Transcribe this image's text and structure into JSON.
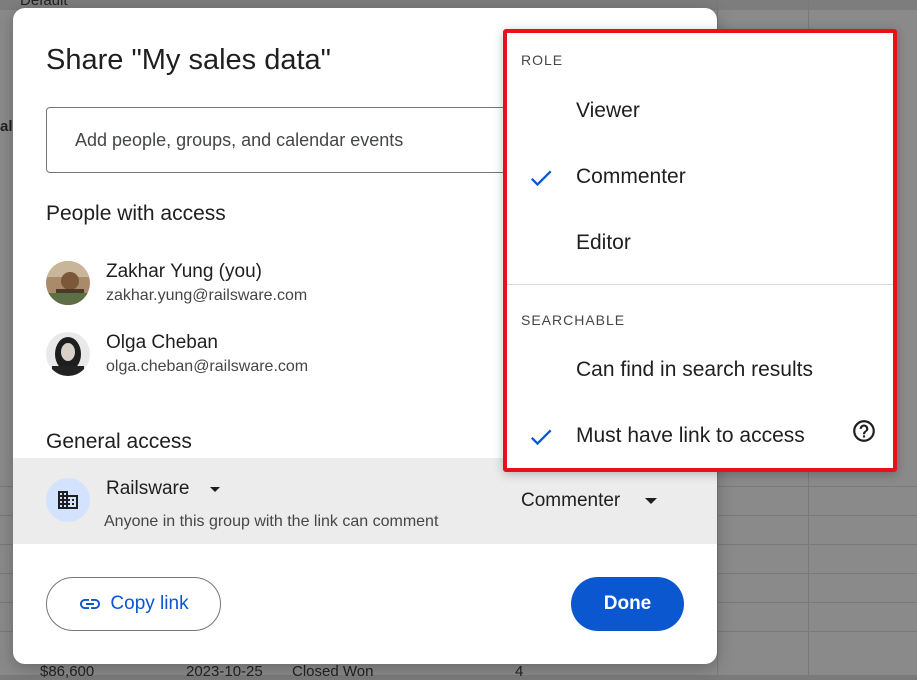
{
  "background": {
    "partial_label": "Default",
    "bottom_cells": [
      "$86,600",
      "2023-10-25",
      "Closed Won",
      "4"
    ],
    "left_header": "al"
  },
  "dialog": {
    "title": "Share \"My sales data\"",
    "add_placeholder": "Add people, groups, and calendar events",
    "people_heading": "People with access",
    "people": [
      {
        "name": "Zakhar Yung (you)",
        "email": "zakhar.yung@railsware.com"
      },
      {
        "name": "Olga Cheban",
        "email": "olga.cheban@railsware.com"
      }
    ],
    "general_heading": "General access",
    "general": {
      "org_name": "Railsware",
      "description": "Anyone in this group with the link can comment",
      "role": "Commenter"
    },
    "copy_link_label": "Copy link",
    "done_label": "Done"
  },
  "menu": {
    "role_heading": "ROLE",
    "roles": [
      {
        "label": "Viewer",
        "checked": false
      },
      {
        "label": "Commenter",
        "checked": true
      },
      {
        "label": "Editor",
        "checked": false
      }
    ],
    "searchable_heading": "SEARCHABLE",
    "searchable": [
      {
        "label": "Can find in search results",
        "checked": false
      },
      {
        "label": "Must have link to access",
        "checked": true
      }
    ]
  },
  "colors": {
    "accent": "#0b57d0",
    "highlight_border": "#e8101c",
    "org_icon_bg": "#d3e3fd"
  }
}
